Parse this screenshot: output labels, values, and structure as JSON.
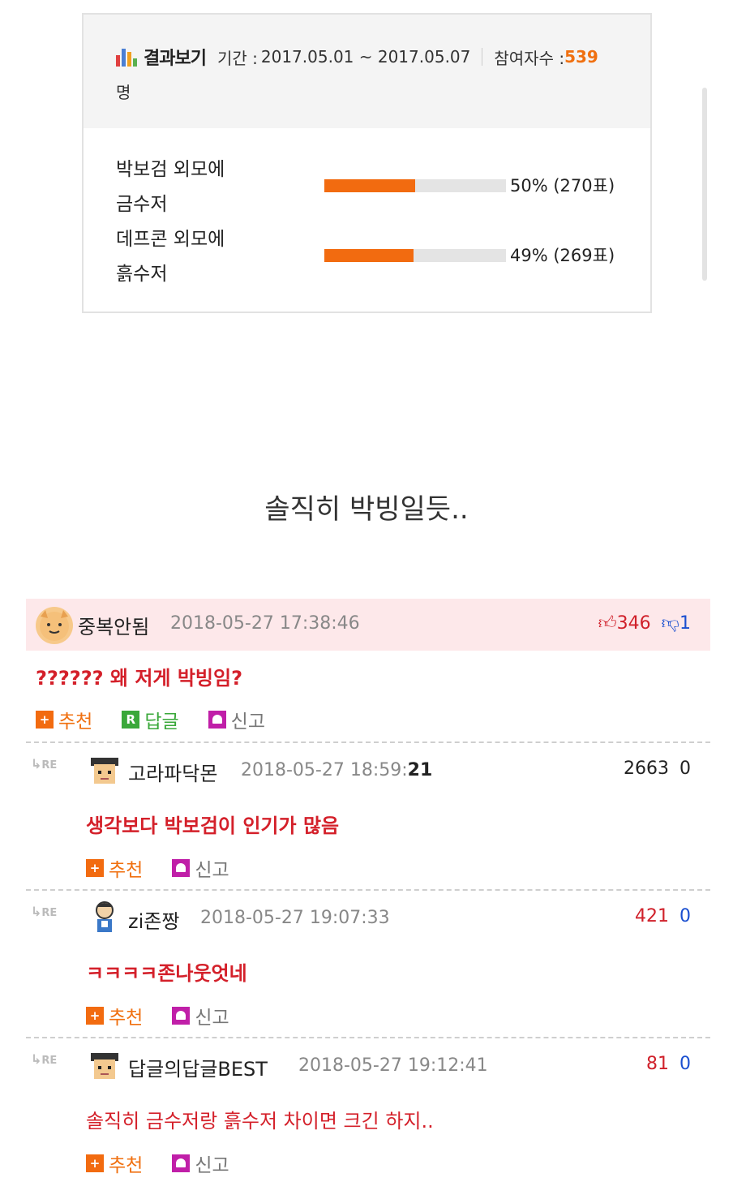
{
  "poll": {
    "title": "결과보기",
    "period_label": "기간 :",
    "period": "2017.05.01 ~ 2017.05.07",
    "participants_label": "참여자수 :",
    "participants_count": "539",
    "participants_unit": "명",
    "items": [
      {
        "label_line1": "박보검 외모에",
        "label_line2": "금수저",
        "percent_text": "50% (270표)",
        "fraction": 0.5
      },
      {
        "label_line1": "데프콘 외모에",
        "label_line2": "흙수저",
        "percent_text": "49% (269표)",
        "fraction": 0.49
      }
    ]
  },
  "post": {
    "text": "솔직히 박빙일듯.."
  },
  "comments": [
    {
      "nickname": "중복안됨",
      "timestamp": "2018-05-27 17:38:46",
      "up": "346",
      "down": "1",
      "text": "?????? 왜 저게 박빙임?",
      "actions": {
        "recommend": "추천",
        "reply": "답글",
        "report": "신고"
      }
    },
    {
      "re": "RE",
      "nickname": "고라파닥몬",
      "timestamp_main": "2018-05-27 18:59:",
      "timestamp_bold": "21",
      "up": "2663",
      "down": "0",
      "text": "생각보다 박보검이 인기가 많음",
      "actions": {
        "recommend": "추천",
        "report": "신고"
      }
    },
    {
      "re": "RE",
      "nickname": "zi존짱",
      "timestamp": "2018-05-27 19:07:33",
      "up": "421",
      "down": "0",
      "text": "ㅋㅋㅋㅋ존나웃엇네",
      "actions": {
        "recommend": "추천",
        "report": "신고"
      }
    },
    {
      "re": "RE",
      "nickname": "답글의답글BEST",
      "timestamp": "2018-05-27 19:12:41",
      "up": "81",
      "down": "0",
      "text": "솔직히 금수저랑 흙수저 차이면 크긴 하지..",
      "actions": {
        "recommend": "추천",
        "report": "신고"
      }
    }
  ],
  "colors": {
    "accent": "#f26b10",
    "upvote": "#d0202a",
    "downvote": "#1a4fd0",
    "highlight_bg": "#fde8ea"
  }
}
